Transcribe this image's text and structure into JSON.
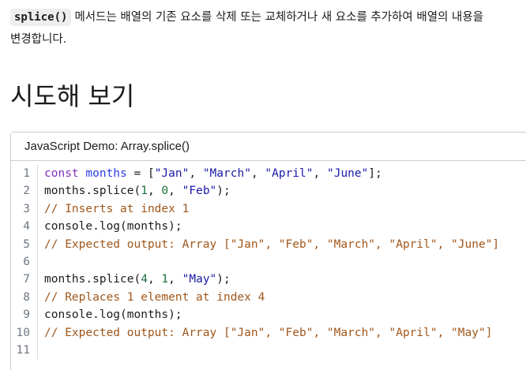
{
  "intro": {
    "code_label": "splice()",
    "text_line1": "메서드는 배열의 기존 요소를 삭제 또는 교체하거나 새 요소를 추가하여 배열의 내용을",
    "text_line2": "변경합니다."
  },
  "section": {
    "title": "시도해 보기"
  },
  "demo": {
    "title": "JavaScript Demo: Array.splice()",
    "lines": [
      {
        "num": "1",
        "tokens": [
          {
            "t": "const",
            "c": "kw"
          },
          {
            "t": " ",
            "c": "plain"
          },
          {
            "t": "months",
            "c": "vname"
          },
          {
            "t": " = [",
            "c": "plain"
          },
          {
            "t": "\"Jan\"",
            "c": "str"
          },
          {
            "t": ", ",
            "c": "plain"
          },
          {
            "t": "\"March\"",
            "c": "str"
          },
          {
            "t": ", ",
            "c": "plain"
          },
          {
            "t": "\"April\"",
            "c": "str"
          },
          {
            "t": ", ",
            "c": "plain"
          },
          {
            "t": "\"June\"",
            "c": "str"
          },
          {
            "t": "];",
            "c": "plain"
          }
        ]
      },
      {
        "num": "2",
        "tokens": [
          {
            "t": "months.splice(",
            "c": "plain"
          },
          {
            "t": "1",
            "c": "num"
          },
          {
            "t": ", ",
            "c": "plain"
          },
          {
            "t": "0",
            "c": "num"
          },
          {
            "t": ", ",
            "c": "plain"
          },
          {
            "t": "\"Feb\"",
            "c": "str"
          },
          {
            "t": ");",
            "c": "plain"
          }
        ]
      },
      {
        "num": "3",
        "tokens": [
          {
            "t": "// Inserts at index 1",
            "c": "cmt"
          }
        ]
      },
      {
        "num": "4",
        "tokens": [
          {
            "t": "console.log(months);",
            "c": "plain"
          }
        ]
      },
      {
        "num": "5",
        "tokens": [
          {
            "t": "// Expected output: Array [\"Jan\", \"Feb\", \"March\", \"April\", \"June\"]",
            "c": "cmt"
          }
        ]
      },
      {
        "num": "6",
        "tokens": []
      },
      {
        "num": "7",
        "tokens": [
          {
            "t": "months.splice(",
            "c": "plain"
          },
          {
            "t": "4",
            "c": "num"
          },
          {
            "t": ", ",
            "c": "plain"
          },
          {
            "t": "1",
            "c": "num"
          },
          {
            "t": ", ",
            "c": "plain"
          },
          {
            "t": "\"May\"",
            "c": "str"
          },
          {
            "t": ");",
            "c": "plain"
          }
        ]
      },
      {
        "num": "8",
        "tokens": [
          {
            "t": "// Replaces 1 element at index 4",
            "c": "cmt"
          }
        ]
      },
      {
        "num": "9",
        "tokens": [
          {
            "t": "console.log(months);",
            "c": "plain"
          }
        ]
      },
      {
        "num": "10",
        "tokens": [
          {
            "t": "// Expected output: Array [\"Jan\", \"Feb\", \"March\", \"April\", \"May\"]",
            "c": "cmt"
          }
        ]
      },
      {
        "num": "11",
        "tokens": []
      }
    ]
  },
  "colors": {
    "keyword": "#7d2fbb",
    "string": "#1a1aa6",
    "variable": "#2a3ee0",
    "number": "#1b6f3c",
    "comment": "#a0561a"
  }
}
